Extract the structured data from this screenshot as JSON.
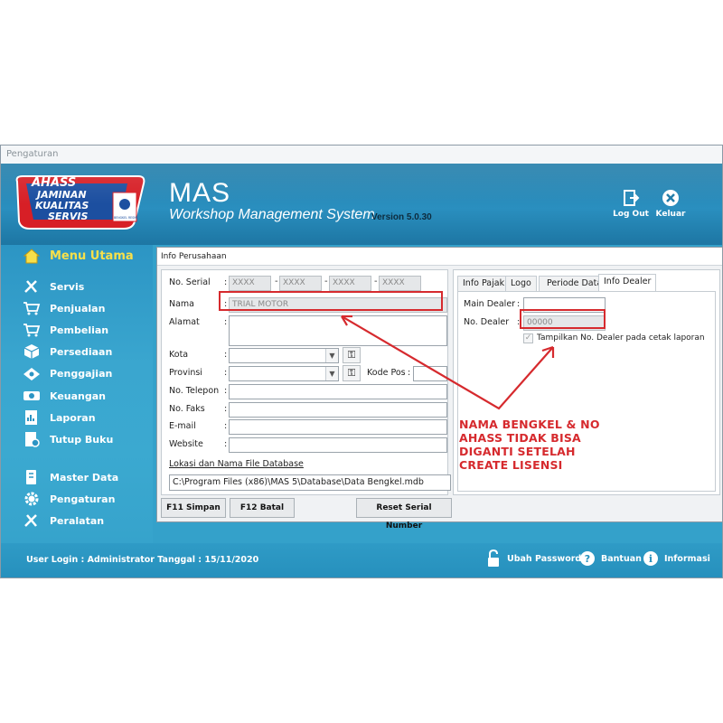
{
  "window": {
    "title": "Pengaturan"
  },
  "header": {
    "logo_text": [
      "AHASS",
      "JAMINAN",
      "KUALITAS",
      "SERVIS",
      "BENGKEL RESMI"
    ],
    "app_name": "MAS",
    "subtitle": "Workshop Management System",
    "version": "Version 5.0.30",
    "logout_label": "Log Out",
    "keluar_label": "Keluar"
  },
  "sidebar": {
    "main": "Menu Utama",
    "items": [
      "Servis",
      "Penjualan",
      "Pembelian",
      "Persediaan",
      "Penggajian",
      "Keuangan",
      "Laporan",
      "Tutup Buku"
    ],
    "items2": [
      "Master Data",
      "Pengaturan",
      "Peralatan"
    ]
  },
  "info": {
    "title": "Info Perusahaan",
    "labels": {
      "serial": "No. Serial",
      "nama": "Nama",
      "alamat": "Alamat",
      "kota": "Kota",
      "provinsi": "Provinsi",
      "kode_pos": "Kode Pos",
      "telepon": "No. Telepon",
      "faks": "No. Faks",
      "email": "E-mail",
      "website": "Website"
    },
    "colon": ":",
    "dash": "-",
    "serial": [
      "XXXX",
      "XXXX",
      "XXXX",
      "XXXX"
    ],
    "nama_value": "TRIAL MOTOR",
    "db_label": "Lokasi dan Nama File Database",
    "db_path": "C:\\Program Files (x86)\\MAS 5\\Database\\Data Bengkel.mdb",
    "buttons": {
      "simpan": "F11 Simpan",
      "batal": "F12 Batal",
      "reset": "Reset Serial Number"
    }
  },
  "tabs": {
    "items": [
      "Info Pajak",
      "Logo",
      "Periode Data",
      "Info Dealer"
    ],
    "active": "Info Dealer",
    "main_dealer_label": "Main Dealer",
    "no_dealer_label": "No. Dealer",
    "no_dealer_value": "00000",
    "checkbox_label": "Tampilkan No. Dealer pada cetak laporan"
  },
  "annotation": {
    "lines": [
      "NAMA BENGKEL & NO",
      "AHASS TIDAK BISA",
      "DIGANTI SETELAH",
      "CREATE LISENSI"
    ],
    "color": "#d62a2e"
  },
  "footer": {
    "user_login": "User Login : Administrator Tanggal : 15/11/2020",
    "ubah_password": "Ubah Password",
    "bantuan": "Bantuan",
    "informasi": "Informasi"
  }
}
